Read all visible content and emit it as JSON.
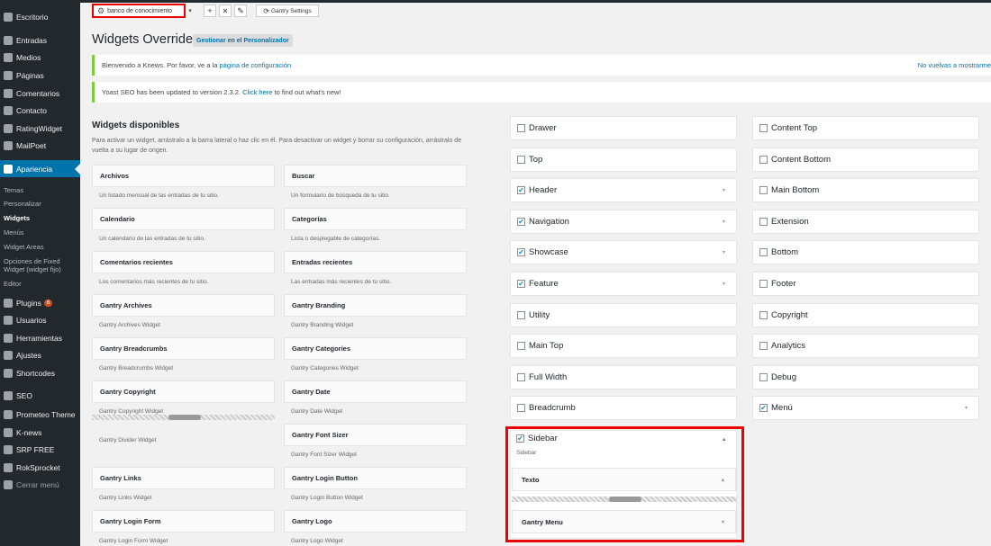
{
  "menu": {
    "items": [
      {
        "label": "Escritorio",
        "icon": "dashboard-icon"
      },
      {
        "label": "Entradas",
        "icon": "pin-icon"
      },
      {
        "label": "Medios",
        "icon": "media-icon"
      },
      {
        "label": "Páginas",
        "icon": "page-icon"
      },
      {
        "label": "Comentarios",
        "icon": "comment-icon"
      },
      {
        "label": "Contacto",
        "icon": "mail-icon"
      },
      {
        "label": "RatingWidget",
        "icon": "rating-icon"
      },
      {
        "label": "MailPoet",
        "icon": "mail-icon"
      },
      {
        "label": "Apariencia",
        "icon": "brush-icon"
      }
    ],
    "submenu": [
      "Temas",
      "Personalizar",
      "Widgets",
      "Menús",
      "Widget Areas",
      "Opciones de Fixed Widget (widget fijo)",
      "Editor"
    ],
    "items2": [
      {
        "label": "Plugins",
        "icon": "plugin-icon",
        "badge": "6"
      },
      {
        "label": "Usuarios",
        "icon": "user-icon"
      },
      {
        "label": "Herramientas",
        "icon": "wrench-icon"
      },
      {
        "label": "Ajustes",
        "icon": "settings-icon"
      },
      {
        "label": "Shortcodes",
        "icon": "code-icon"
      },
      {
        "label": "SEO",
        "icon": "seo-icon"
      },
      {
        "label": "Prometeo Theme",
        "icon": "theme-icon"
      },
      {
        "label": "K-news",
        "icon": "news-icon"
      },
      {
        "label": "SRP FREE",
        "icon": "srp-icon"
      },
      {
        "label": "RokSprocket",
        "icon": "rocket-icon"
      },
      {
        "label": "Cerrar menú",
        "icon": "collapse-icon"
      }
    ]
  },
  "toolbar": {
    "kb_label": "banco de conocimiento",
    "dropdown_glyph": "▾",
    "add_glyph": "+",
    "remove_glyph": "✕",
    "edit_glyph": "✎",
    "gantry_label": "Gantry Settings"
  },
  "page": {
    "title": "Widgets Override",
    "manage_button": "Gestionar en el Personalizador"
  },
  "notices": {
    "knews_text": "Bienvenido a Knews. Por favor, ve a la",
    "knews_link": "página de configuración",
    "knews_dismiss": "No vuelvas a mostrarme",
    "yoast_text": "Yoast SEO has been updated to version 2.3.2.",
    "yoast_link": "Click here",
    "yoast_text2": "to find out what's new!"
  },
  "available": {
    "title": "Widgets disponibles",
    "desc": "Para activar un widget, arrástralo a la barra lateral o haz clic en él. Para desactivar un widget y borrar su configuración, arrástralo de vuelta a su lugar de origen.",
    "widgets": [
      {
        "title": "Archivos",
        "desc": "Un listado mensual de las entradas de tu sitio."
      },
      {
        "title": "Buscar",
        "desc": "Un formulario de búsqueda de tu sitio."
      },
      {
        "title": "Calendario",
        "desc": "Un calendario de las entradas de tu sitio."
      },
      {
        "title": "Categorías",
        "desc": "Lista o desplegable de categorías."
      },
      {
        "title": "Comentarios recientes",
        "desc": "Los comentarios más recientes de tu sitio."
      },
      {
        "title": "Entradas recientes",
        "desc": "Las entradas más recientes de tu sitio."
      },
      {
        "title": "Gantry Archives",
        "desc": "Gantry Archives Widget"
      },
      {
        "title": "Gantry Branding",
        "desc": "Gantry Branding Widget"
      },
      {
        "title": "Gantry Breadcrumbs",
        "desc": "Gantry Breadcrumbs Widget"
      },
      {
        "title": "Gantry Categories",
        "desc": "Gantry Categories Widget"
      },
      {
        "title": "Gantry Copyright",
        "desc": "Gantry Copyright Widget"
      },
      {
        "title": "Gantry Date",
        "desc": "Gantry Date Widget"
      },
      {
        "title": "",
        "desc": "Gantry Divider Widget"
      },
      {
        "title": "Gantry Font Sizer",
        "desc": "Gantry Font Sizer Widget"
      },
      {
        "title": "Gantry Links",
        "desc": "Gantry Links Widget"
      },
      {
        "title": "Gantry Login Button",
        "desc": "Gantry Login Button Widget"
      },
      {
        "title": "Gantry Login Form",
        "desc": "Gantry Login Form Widget"
      },
      {
        "title": "Gantry Logo",
        "desc": "Gantry Logo Widget"
      }
    ]
  },
  "areas": {
    "col1": [
      {
        "label": "Drawer",
        "checked": false,
        "arrow": false
      },
      {
        "label": "Top",
        "checked": false,
        "arrow": false
      },
      {
        "label": "Header",
        "checked": true,
        "arrow": true
      },
      {
        "label": "Navigation",
        "checked": true,
        "arrow": true
      },
      {
        "label": "Showcase",
        "checked": true,
        "arrow": true
      },
      {
        "label": "Feature",
        "checked": true,
        "arrow": true
      },
      {
        "label": "Utility",
        "checked": false,
        "arrow": false
      },
      {
        "label": "Main Top",
        "checked": false,
        "arrow": false
      },
      {
        "label": "Full Width",
        "checked": false,
        "arrow": false
      },
      {
        "label": "Breadcrumb",
        "checked": false,
        "arrow": false
      }
    ],
    "col2": [
      {
        "label": "Content Top",
        "checked": false,
        "arrow": false
      },
      {
        "label": "Content Bottom",
        "checked": false,
        "arrow": false
      },
      {
        "label": "Main Bottom",
        "checked": false,
        "arrow": false
      },
      {
        "label": "Extension",
        "checked": false,
        "arrow": false
      },
      {
        "label": "Bottom",
        "checked": false,
        "arrow": false
      },
      {
        "label": "Footer",
        "checked": false,
        "arrow": false
      },
      {
        "label": "Copyright",
        "checked": false,
        "arrow": false
      },
      {
        "label": "Analytics",
        "checked": false,
        "arrow": false
      },
      {
        "label": "Debug",
        "checked": false,
        "arrow": false
      },
      {
        "label": "Menú",
        "checked": true,
        "arrow": true
      }
    ],
    "sidebar": {
      "label": "Sidebar",
      "desc": "Sidebar",
      "widgets": [
        {
          "title": "Texto",
          "arrow": "▴"
        },
        {
          "title": "Gantry Menu",
          "arrow": "▾"
        }
      ]
    }
  },
  "glyphs": {
    "check": "✔",
    "down": "▾",
    "up": "▴",
    "gear": "⚙",
    "refresh": "⟳"
  }
}
